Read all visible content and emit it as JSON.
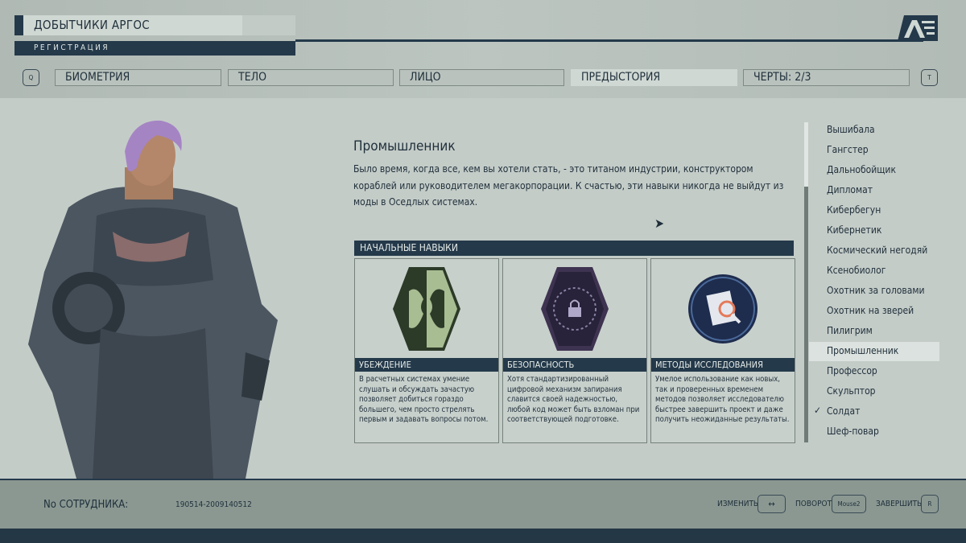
{
  "header": {
    "title": "ДОБЫТЧИКИ АРГОС",
    "subtitle": "РЕГИСТРАЦИЯ",
    "left_key": "Q",
    "right_key": "T",
    "tabs": [
      {
        "label": "БИОМЕТРИЯ"
      },
      {
        "label": "ТЕЛО"
      },
      {
        "label": "ЛИЦО"
      },
      {
        "label": "ПРЕДЫСТОРИЯ",
        "active": true
      },
      {
        "label": "ЧЕРТЫ: 2/3"
      }
    ]
  },
  "background": {
    "title": "Промышленник",
    "description": "Было время, когда все, кем вы хотели стать, - это титаном индустрии, конструктором кораблей или руководителем мегакорпорации. К счастью, эти навыки никогда не выйдут из моды в Оседлых системах."
  },
  "skills": {
    "header": "НАЧАЛЬНЫЕ НАВЫКИ",
    "items": [
      {
        "name": "УБЕЖДЕНИЕ",
        "icon": "persuasion-icon",
        "description": "В расчетных системах умение слушать и обсуждать зачастую позволяет добиться гораздо большего, чем просто стрелять первым и задавать вопросы потом."
      },
      {
        "name": "БЕЗОПАСНОСТЬ",
        "icon": "security-icon",
        "description": "Хотя стандартизированный цифровой механизм запирания славится своей надежностью, любой код может быть взломан при соответствующей подготовке."
      },
      {
        "name": "МЕТОДЫ ИССЛЕДОВАНИЯ",
        "icon": "research-methods-icon",
        "description": "Умелое использование как новых, так и проверенных временем методов позволяет исследователю быстрее завершить проект и даже получить неожиданные результаты."
      }
    ]
  },
  "list": [
    {
      "label": "Вышибала"
    },
    {
      "label": "Гангстер"
    },
    {
      "label": "Дальнобойщик"
    },
    {
      "label": "Дипломат"
    },
    {
      "label": "Кибербегун"
    },
    {
      "label": "Кибернетик"
    },
    {
      "label": "Космический негодяй"
    },
    {
      "label": "Ксенобиолог"
    },
    {
      "label": "Охотник за головами"
    },
    {
      "label": "Охотник на зверей"
    },
    {
      "label": "Пилигрим"
    },
    {
      "label": "Промышленник",
      "selected": true
    },
    {
      "label": "Профессор"
    },
    {
      "label": "Скульптор"
    },
    {
      "label": "Солдат",
      "checked": true,
      "check": "✓"
    },
    {
      "label": "Шеф-повар"
    }
  ],
  "footer": {
    "employee_label": "No СОТРУДНИКА:",
    "employee_id": "190514-2009140512",
    "change_label": "ИЗМЕНИТЬ",
    "change_key": "↔",
    "rotate_label": "ПОВОРОТ",
    "rotate_key": "Mouse2",
    "finish_label": "ЗАВЕРШИТЬ",
    "finish_key": "R"
  },
  "colors": {
    "dark": "#24394a",
    "panel": "#c4ccc8",
    "footer": "#8b9892"
  }
}
